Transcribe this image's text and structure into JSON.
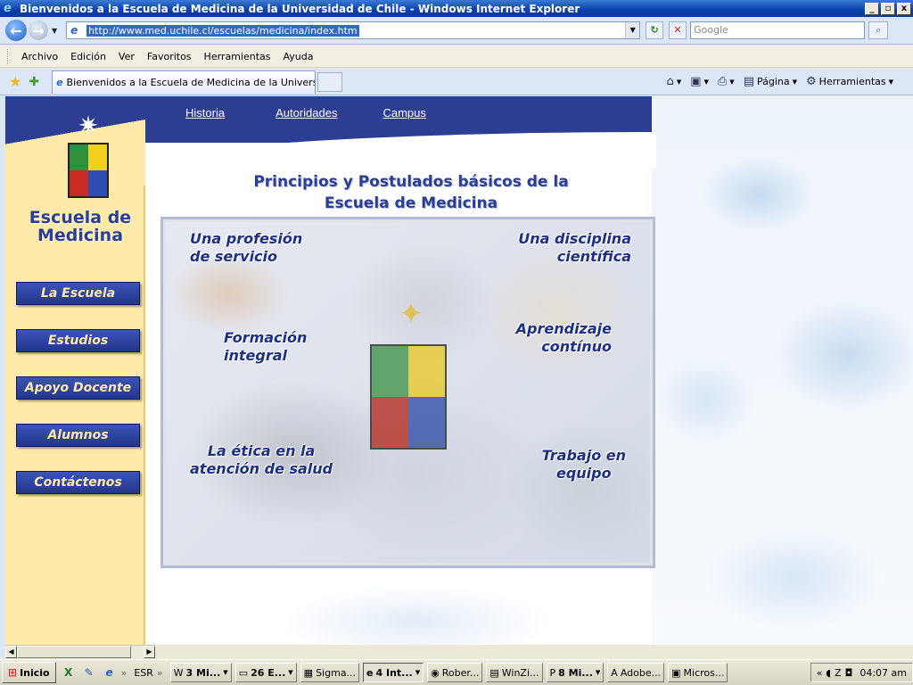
{
  "window": {
    "title": "Bienvenidos a la Escuela de Medicina de la Universidad de Chile - Windows Internet Explorer",
    "controls": [
      "_",
      "▫",
      "x"
    ]
  },
  "addressbar": {
    "url": "http://www.med.uchile.cl/escuelas/medicina/index.htm",
    "search_placeholder": "Google"
  },
  "menubar": [
    "Archivo",
    "Edición",
    "Ver",
    "Favoritos",
    "Herramientas",
    "Ayuda"
  ],
  "tabs": {
    "active_label": "Bienvenidos a la Escuela de Medicina de la Universida...",
    "commands": [
      "Página",
      "Herramientas"
    ]
  },
  "page": {
    "top_links": [
      "Historia",
      "Autoridades",
      "Campus"
    ],
    "brand_line1": "Escuela de",
    "brand_line2": "Medicina",
    "sidebar_nav": [
      "La Escuela",
      "Estudios",
      "Apoyo Docente",
      "Alumnos",
      "Contáctenos"
    ],
    "heading_line1": "Principios y Postulados básicos de la",
    "heading_line2": "Escuela de Medicina",
    "principles": [
      "Una profesión\nde servicio",
      "Una disciplina\ncientífica",
      "Formación\nintegral",
      "Aprendizaje\ncontínuo",
      "La ética en la\natención de salud",
      "Trabajo en\nequipo"
    ]
  },
  "taskbar": {
    "start": "Inicio",
    "esr": "ESR",
    "items": [
      "3 Mi...",
      "26 E...",
      "Sigma...",
      "4 Int...",
      "Rober...",
      "WinZi...",
      "8 Mi...",
      "Adobe...",
      "Micros..."
    ],
    "clock": "04:07 am"
  },
  "icons": {
    "ie": "internet-explorer-icon",
    "back": "back-arrow-icon",
    "forward": "forward-arrow-icon",
    "refresh": "refresh-icon",
    "stop": "stop-icon",
    "search": "search-icon",
    "favorites": "star-icon",
    "home": "home-icon",
    "print": "printer-icon",
    "feed": "rss-icon"
  }
}
